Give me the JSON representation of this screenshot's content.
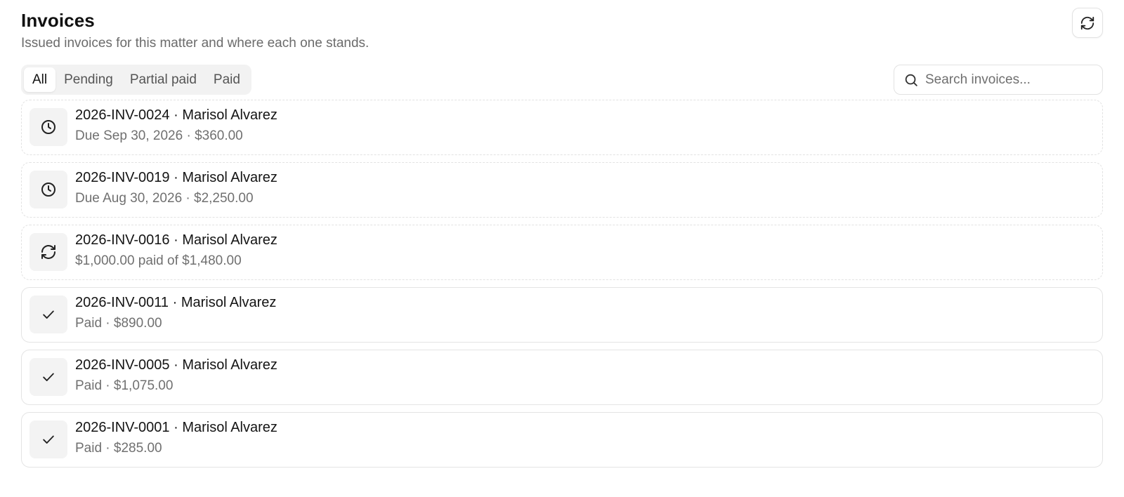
{
  "header": {
    "title": "Invoices",
    "subtitle": "Issued invoices for this matter and where each one stands.",
    "refresh_icon": "refresh-icon"
  },
  "filters": {
    "tabs": [
      {
        "label": "All",
        "active": true
      },
      {
        "label": "Pending",
        "active": false
      },
      {
        "label": "Partial paid",
        "active": false
      },
      {
        "label": "Paid",
        "active": false
      }
    ],
    "search": {
      "placeholder": "Search invoices...",
      "icon": "search-icon"
    }
  },
  "invoices": [
    {
      "title": "2026-INV-0024 · Marisol Alvarez",
      "subtitle": "Due Sep 30, 2026 · $360.00",
      "status": "pending",
      "icon": "clock-icon"
    },
    {
      "title": "2026-INV-0019 · Marisol Alvarez",
      "subtitle": "Due Aug 30, 2026 · $2,250.00",
      "status": "pending",
      "icon": "clock-icon"
    },
    {
      "title": "2026-INV-0016 · Marisol Alvarez",
      "subtitle": "$1,000.00 paid of $1,480.00",
      "status": "partial",
      "icon": "refresh-icon"
    },
    {
      "title": "2026-INV-0011 · Marisol Alvarez",
      "subtitle": "Paid · $890.00",
      "status": "paid",
      "icon": "check-icon"
    },
    {
      "title": "2026-INV-0005 · Marisol Alvarez",
      "subtitle": "Paid · $1,075.00",
      "status": "paid",
      "icon": "check-icon"
    },
    {
      "title": "2026-INV-0001 · Marisol Alvarez",
      "subtitle": "Paid · $285.00",
      "status": "paid",
      "icon": "check-icon"
    }
  ],
  "colors": {
    "text_primary": "#111111",
    "text_secondary": "#6b6b6b",
    "border": "#e4e4e4",
    "icon_bg": "#f3f3f3",
    "tab_bg": "#f2f2f2"
  }
}
